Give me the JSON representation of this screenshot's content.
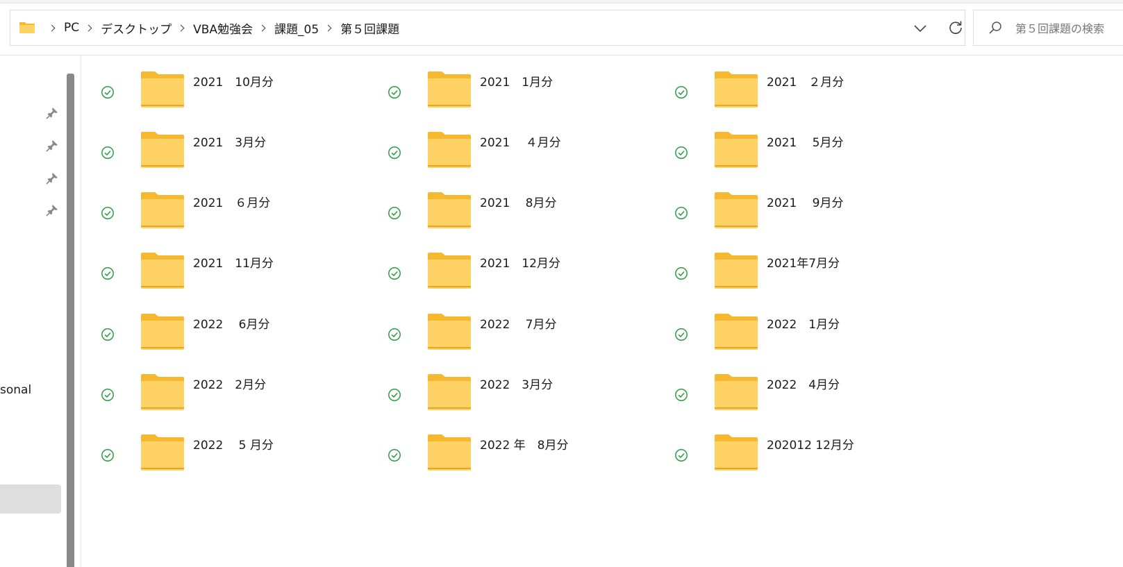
{
  "address_bar": {
    "breadcrumbs": [
      "PC",
      "デスクトップ",
      "VBA勉強会",
      "課題_05",
      "第５回課題"
    ]
  },
  "search": {
    "placeholder": "第５回課題の検索"
  },
  "nav": {
    "partial_label": "sonal"
  },
  "folders": [
    {
      "name": "2021　10月分",
      "status": "synced"
    },
    {
      "name": "2021　1月分",
      "status": "synced"
    },
    {
      "name": "2021　２月分",
      "status": "synced"
    },
    {
      "name": "2021　3月分",
      "status": "synced"
    },
    {
      "name": "2021　 ４月分",
      "status": "synced"
    },
    {
      "name": "2021　 5月分",
      "status": "synced"
    },
    {
      "name": "2021　６月分",
      "status": "synced"
    },
    {
      "name": "2021　 8月分",
      "status": "synced"
    },
    {
      "name": "2021　 9月分",
      "status": "synced"
    },
    {
      "name": "2021　11月分",
      "status": "synced"
    },
    {
      "name": "2021　12月分",
      "status": "synced"
    },
    {
      "name": "2021年7月分",
      "status": "synced"
    },
    {
      "name": "2022　 6月分",
      "status": "synced"
    },
    {
      "name": "2022　 7月分",
      "status": "synced"
    },
    {
      "name": "2022　1月分",
      "status": "synced"
    },
    {
      "name": "2022　2月分",
      "status": "synced"
    },
    {
      "name": "2022　3月分",
      "status": "synced"
    },
    {
      "name": "2022　4月分",
      "status": "synced"
    },
    {
      "name": "2022　 5 月分",
      "status": "synced"
    },
    {
      "name": "2022 年　8月分",
      "status": "synced"
    },
    {
      "name": "202012 12月分",
      "status": "synced"
    }
  ],
  "colors": {
    "sync_green": "#2e9e44",
    "folder_back": "#f5b82e",
    "folder_front": "#ffd266"
  }
}
